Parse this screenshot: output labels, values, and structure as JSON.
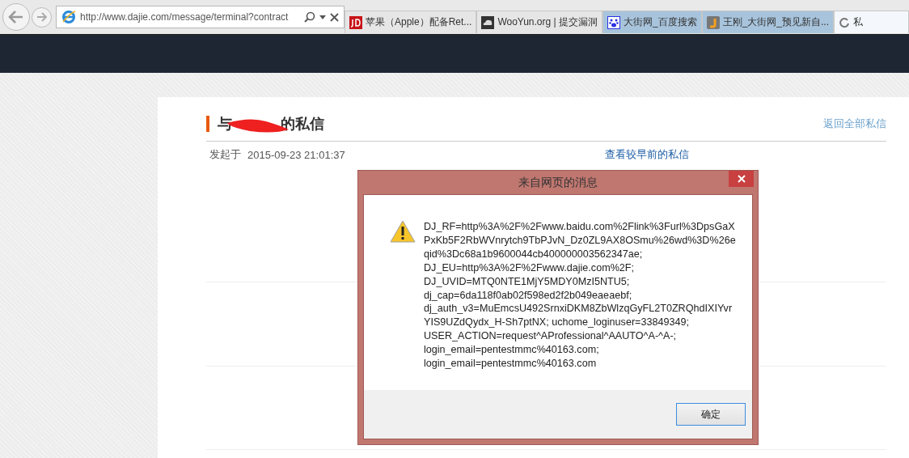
{
  "browser": {
    "address": "http://www.dajie.com/message/terminal?contract",
    "tabs": [
      {
        "title": "苹果（Apple）配备Ret...",
        "grouped": false,
        "selected": false
      },
      {
        "title": "WooYun.org | 提交漏洞",
        "grouped": false,
        "selected": false
      },
      {
        "title": "大街网_百度搜索",
        "grouped": true,
        "selected": false
      },
      {
        "title": "王刚_大街网_预见新自...",
        "grouped": true,
        "selected": false
      },
      {
        "title": "私",
        "grouped": false,
        "selected": true
      }
    ]
  },
  "page": {
    "title_start": "与",
    "title_end": "的私信",
    "back_link": "返回全部私信",
    "started_label": "发起于",
    "started_time": "2015-09-23 21:01:37",
    "earlier_link": "查看较早前的私信"
  },
  "dialog": {
    "title": "来自网页的消息",
    "lines": [
      "DJ_RF=http%3A%2F%2Fwww.baidu.com%2Flink%3Furl%3DpsGaX",
      "PxKb5F2RbWVnrytch9TbPJvN_Dz0ZL9AX8OSmu%26wd%3D%26e",
      "qid%3Dc68a1b9600044cb400000003562347ae;",
      "DJ_EU=http%3A%2F%2Fwww.dajie.com%2F;",
      "DJ_UVID=MTQ0NTE1MjY5MDY0MzI5NTU5;",
      "dj_cap=6da118f0ab02f598ed2f2b049eaeaebf;",
      "dj_auth_v3=MuEmcsU492SrnxiDKM8ZbWlzqGyFL2T0ZRQhdIXIYvr",
      "YIS9UZdQydx_H-Sh7ptNX; uchome_loginuser=33849349;",
      "USER_ACTION=request^AProfessional^AAUTO^A-^A-;",
      "login_email=pentestmmc%40163.com;",
      "login_email=pentestmmc%40163.com"
    ],
    "ok_button": "确定"
  }
}
